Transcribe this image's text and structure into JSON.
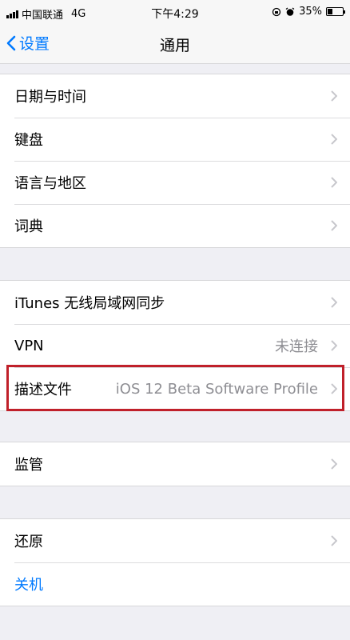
{
  "status_bar": {
    "carrier": "中国联通",
    "network": "4G",
    "time": "下午4:29",
    "battery": "35%",
    "battery_level": 0.35
  },
  "nav": {
    "back_label": "设置",
    "title": "通用"
  },
  "groups": [
    {
      "items": [
        {
          "label": "日期与时间"
        },
        {
          "label": "键盘"
        },
        {
          "label": "语言与地区"
        },
        {
          "label": "词典"
        }
      ]
    },
    {
      "items": [
        {
          "label": "iTunes 无线局域网同步"
        },
        {
          "label": "VPN",
          "value": "未连接"
        },
        {
          "label": "描述文件",
          "value": "iOS 12 Beta Software Profile"
        }
      ]
    },
    {
      "items": [
        {
          "label": "监管"
        }
      ]
    },
    {
      "items": [
        {
          "label": "还原"
        },
        {
          "label": "关机"
        }
      ]
    }
  ],
  "colors": {
    "accent": "#007aff",
    "highlight_border": "#c0202a",
    "secondary_text": "#8e8e93"
  }
}
